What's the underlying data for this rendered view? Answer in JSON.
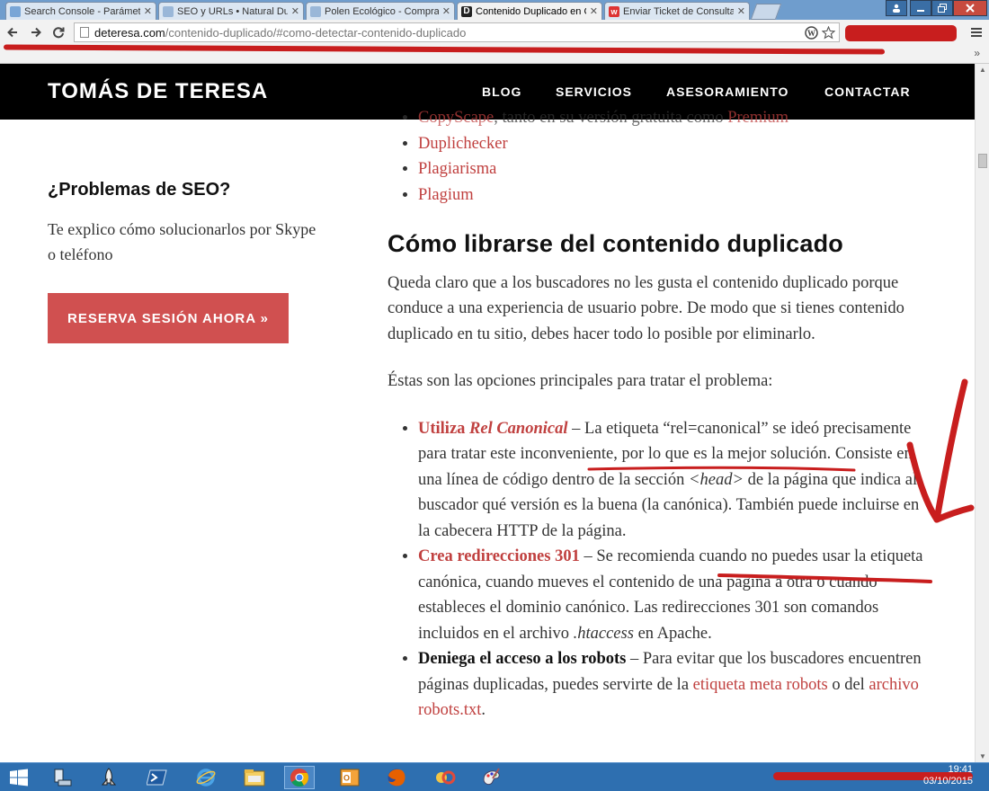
{
  "browser": {
    "tabs": [
      {
        "label": "Search Console - Parámetros",
        "icon": "search-console-icon",
        "active": false
      },
      {
        "label": "SEO y URLs • Natural Dubai",
        "icon": "cloud-icon",
        "active": false
      },
      {
        "label": "Polen Ecológico - Comprar",
        "icon": "cloud-icon",
        "active": false
      },
      {
        "label": "Contenido Duplicado en Google",
        "icon": "d-logo-icon",
        "active": true
      },
      {
        "label": "Enviar Ticket de Consulta",
        "icon": "w-logo-icon",
        "active": false
      }
    ],
    "url_host": "deteresa.com",
    "url_path": "/contenido-duplicado/#como-detectar-contenido-duplicado"
  },
  "site": {
    "brand": "TOMÁS DE TERESA",
    "nav": [
      "BLOG",
      "SERVICIOS",
      "ASESORAMIENTO",
      "CONTACTAR"
    ]
  },
  "sidebar": {
    "heading": "¿Problemas de SEO?",
    "text": "Te explico cómo solucionarlos por Skype o teléfono",
    "cta": "RESERVA SESIÓN AHORA »"
  },
  "article": {
    "cut_item": {
      "link": "CopyScape",
      "text": ", tanto en su versión gratuita como ",
      "link2": "Premium"
    },
    "tools": [
      "Duplichecker",
      "Plagiarisma",
      "Plagium"
    ],
    "heading": "Cómo librarse del contenido duplicado",
    "para1": "Queda claro que a los buscadores no les gusta el contenido duplicado porque conduce a una experiencia de usuario pobre. De modo que si tienes contenido duplicado en tu sitio, debes hacer todo lo posible por eliminarlo.",
    "para2": "Éstas son las opciones principales para tratar el problema:",
    "opt1": {
      "lead_a": "Utiliza ",
      "lead_b": "Rel Canonical",
      "dash": " – ",
      "t1": "La etiqueta “rel=canonical” se ideó precisamente para tratar este inconveniente, por lo que es la mejor solución. Consiste en una línea de código dentro de la sección ",
      "code": "<head>",
      "t2": " de la página que indica al buscador qué versión es la buena (la canónica). También puede incluirse en la cabecera HTTP de la página."
    },
    "opt2": {
      "lead": "Crea redirecciones 301",
      "t1": " – Se recomienda cuando no puedes usar la etiqueta canónica, cuando mueves el contenido de una página a otra o cuando estableces el dominio canónico. Las redirecciones 301 son comandos incluidos en el archivo ",
      "code": ".htaccess",
      "t2": " en Apache."
    },
    "opt3": {
      "lead": "Deniega el acceso a los robots",
      "t1": " – Para evitar que los buscadores encuentren páginas duplicadas, puedes servirte de la ",
      "link1": "etiqueta meta robots",
      "t2": " o del ",
      "link2": "archivo robots.txt",
      "t3": "."
    }
  },
  "taskbar": {
    "time": "19:41",
    "date": "03/10/2015"
  }
}
